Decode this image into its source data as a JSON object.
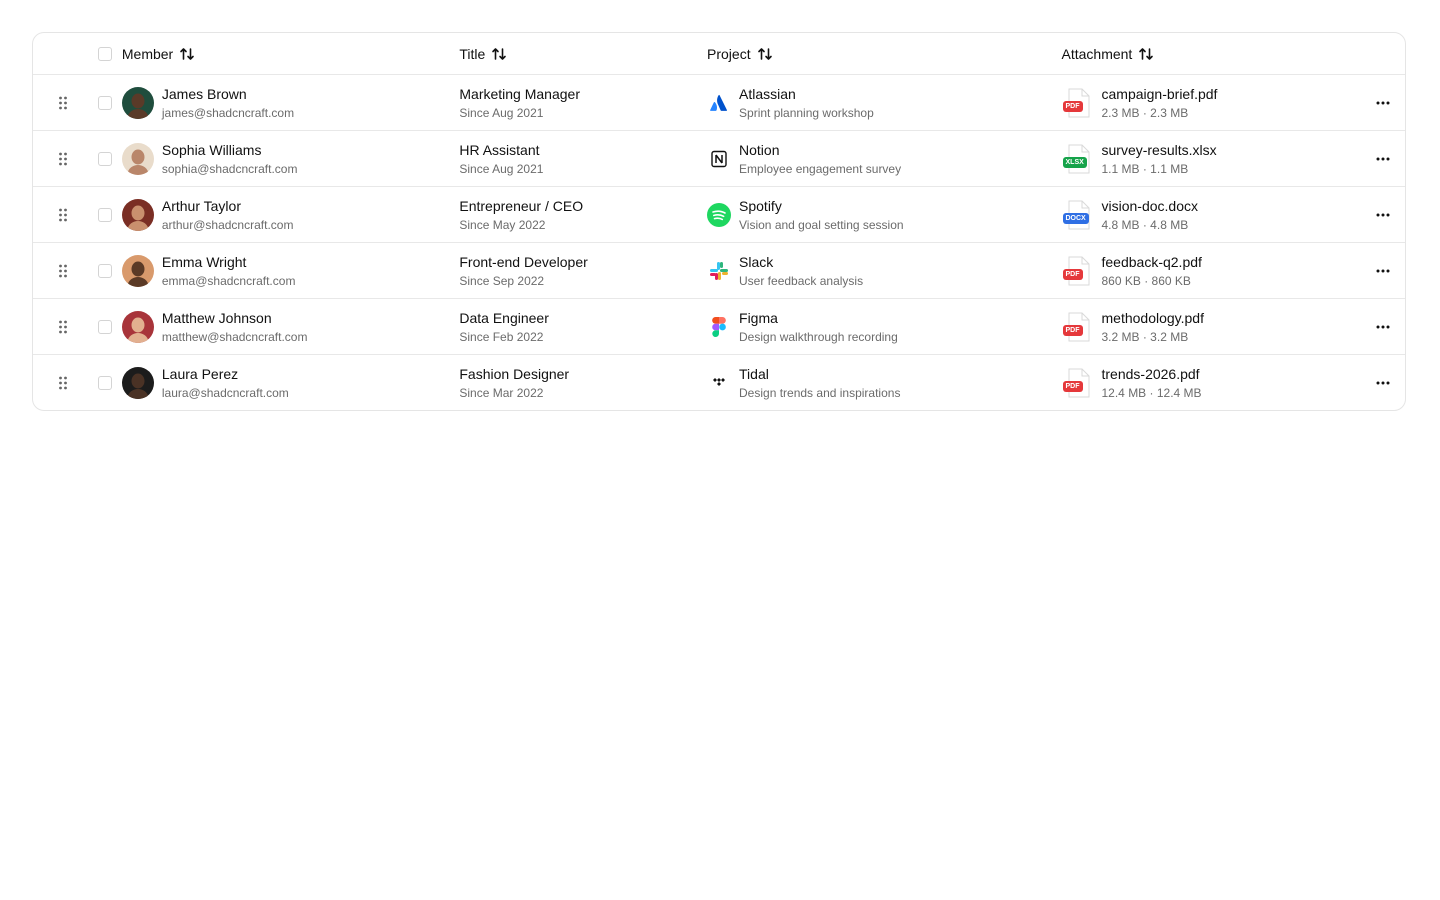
{
  "header": {
    "member": "Member",
    "title": "Title",
    "project": "Project",
    "attachment": "Attachment"
  },
  "rows": [
    {
      "name": "James Brown",
      "email": "james@shadcncraft.com",
      "title": "Marketing Manager",
      "since": "Since Aug 2021",
      "project": "Atlassian",
      "project_desc": "Sprint planning workshop",
      "project_icon": "atlassian-logo-icon",
      "file": "campaign-brief.pdf",
      "file_size": "2.3 MB · 2.3 MB",
      "file_type": "PDF",
      "file_color": "#e5383b",
      "avatar_bg": "#1f4d3d",
      "avatar_face": "#5a3a28"
    },
    {
      "name": "Sophia Williams",
      "email": "sophia@shadcncraft.com",
      "title": "HR Assistant",
      "since": "Since Aug 2021",
      "project": "Notion",
      "project_desc": "Employee engagement survey",
      "project_icon": "notion-logo-icon",
      "file": "survey-results.xlsx",
      "file_size": "1.1 MB · 1.1 MB",
      "file_type": "XLSX",
      "file_color": "#16a34a",
      "avatar_bg": "#e9dccb",
      "avatar_face": "#b9866a"
    },
    {
      "name": "Arthur Taylor",
      "email": "arthur@shadcncraft.com",
      "title": "Entrepreneur / CEO",
      "since": "Since May 2022",
      "project": "Spotify",
      "project_desc": "Vision and goal setting session",
      "project_icon": "spotify-logo-icon",
      "file": "vision-doc.docx",
      "file_size": "4.8 MB · 4.8 MB",
      "file_type": "DOCX",
      "file_color": "#2f6fe4",
      "avatar_bg": "#7a2e24",
      "avatar_face": "#c9906e"
    },
    {
      "name": "Emma Wright",
      "email": "emma@shadcncraft.com",
      "title": "Front-end Developer",
      "since": "Since Sep 2022",
      "project": "Slack",
      "project_desc": "User feedback analysis",
      "project_icon": "slack-logo-icon",
      "file": "feedback-q2.pdf",
      "file_size": "860 KB · 860 KB",
      "file_type": "PDF",
      "file_color": "#e5383b",
      "avatar_bg": "#d99a6c",
      "avatar_face": "#5b3a26"
    },
    {
      "name": "Matthew Johnson",
      "email": "matthew@shadcncraft.com",
      "title": "Data Engineer",
      "since": "Since Feb 2022",
      "project": "Figma",
      "project_desc": "Design walkthrough recording",
      "project_icon": "figma-logo-icon",
      "file": "methodology.pdf",
      "file_size": "3.2 MB · 3.2 MB",
      "file_type": "PDF",
      "file_color": "#e5383b",
      "avatar_bg": "#a8343a",
      "avatar_face": "#e2b090"
    },
    {
      "name": "Laura Perez",
      "email": "laura@shadcncraft.com",
      "title": "Fashion Designer",
      "since": "Since Mar 2022",
      "project": "Tidal",
      "project_desc": "Design trends and inspirations",
      "project_icon": "tidal-logo-icon",
      "file": "trends-2026.pdf",
      "file_size": "12.4 MB · 12.4 MB",
      "file_type": "PDF",
      "file_color": "#e5383b",
      "avatar_bg": "#1c1c1c",
      "avatar_face": "#4a3225"
    }
  ],
  "colors": {
    "border": "#e5e5e5",
    "muted_text": "#6b6b6b",
    "text": "#111111"
  }
}
